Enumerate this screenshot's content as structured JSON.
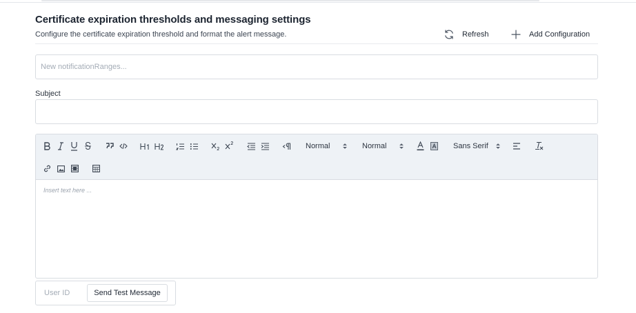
{
  "header": {
    "title": "Certificate expiration thresholds and messaging settings",
    "description": "Configure the certificate expiration threshold and format the alert message.",
    "refresh_label": "Refresh",
    "add_configuration_label": "Add Configuration"
  },
  "ranges_field": {
    "value": "",
    "placeholder": "New notificationRanges..."
  },
  "subject_field": {
    "label": "Subject",
    "value": "",
    "placeholder": ""
  },
  "editor": {
    "toolbar": {
      "header_select": "Normal",
      "size_select": "Normal",
      "font_select": "Sans Serif",
      "icons": [
        "bold-icon",
        "italic-icon",
        "underline-icon",
        "strikethrough-icon",
        "blockquote-icon",
        "code-block-icon",
        "heading-1-icon",
        "heading-2-icon",
        "ordered-list-icon",
        "bullet-list-icon",
        "subscript-icon",
        "superscript-icon",
        "outdent-icon",
        "indent-icon",
        "text-direction-icon",
        "font-color-icon",
        "background-color-icon",
        "align-icon",
        "clear-formatting-icon",
        "link-icon",
        "image-icon",
        "video-icon",
        "table-icon"
      ]
    },
    "placeholder": "Insert text here ..."
  },
  "test_message": {
    "user_id_placeholder": "User ID",
    "send_label": "Send Test Message"
  },
  "colors": {
    "text": "#1f2733",
    "muted": "#a4acb6",
    "border": "#d8dce1",
    "toolbar_bg": "#eef2f6"
  }
}
